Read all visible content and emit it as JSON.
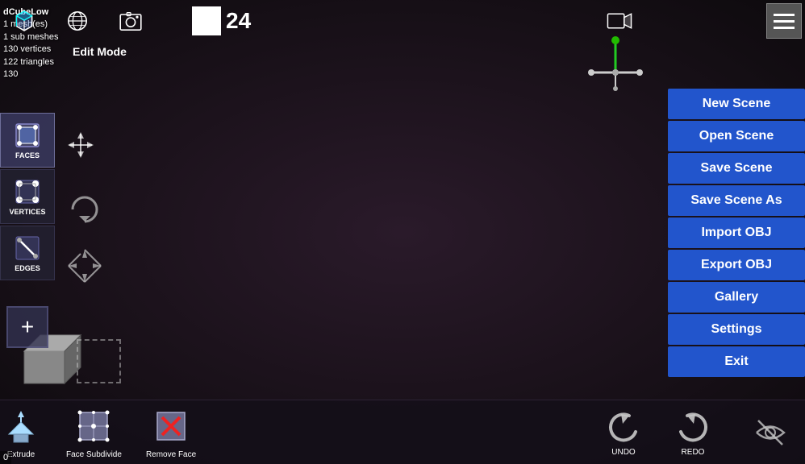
{
  "info": {
    "object_name": "dCubeLow",
    "mesh_count": "1 mesh(es)",
    "sub_meshes": "1 sub meshes",
    "vertices": "130 vertices",
    "triangles": "122 triangles",
    "extra": "130"
  },
  "toolbar": {
    "edit_mode_label": "Edit Mode",
    "frame_number": "24"
  },
  "menu": {
    "new_scene": "New Scene",
    "open_scene": "Open Scene",
    "save_scene": "Save Scene",
    "save_scene_as": "Save Scene As",
    "import_obj": "Import OBJ",
    "export_obj": "Export OBJ",
    "gallery": "Gallery",
    "settings": "Settings",
    "exit": "Exit"
  },
  "left_tools": {
    "faces_label": "FACES",
    "vertices_label": "VERTICES",
    "edges_label": "EDGES"
  },
  "bottom_tools": {
    "extrude_label": "Extrude",
    "face_subdivide_label": "Face Subdivide",
    "remove_face_label": "Remove Face",
    "undo_label": "UNDO",
    "redo_label": "REDO"
  },
  "coords": {
    "display": "0"
  },
  "colors": {
    "menu_bg": "#2255cc",
    "axis_x": "#cc2222",
    "axis_y": "#22cc22",
    "axis_z": "#2222cc",
    "accent": "#4466ee"
  }
}
